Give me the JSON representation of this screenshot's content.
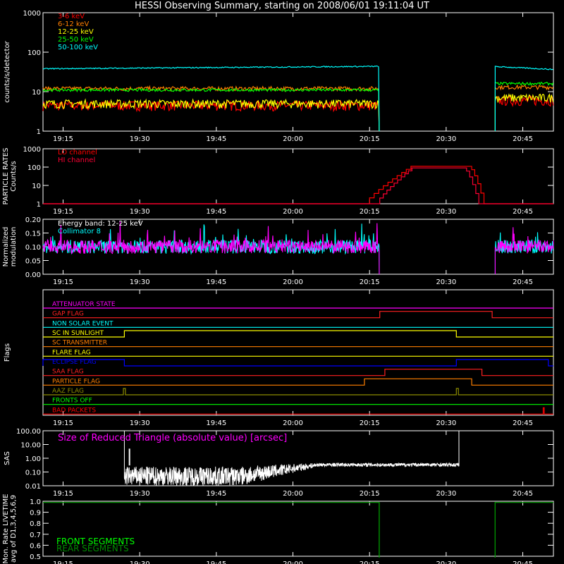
{
  "title": "HESSI Observing Summary, starting on 2008/06/01 19:11:04 UT",
  "time_ticks": [
    "19:15",
    "19:30",
    "19:45",
    "20:00",
    "20:15",
    "20:30",
    "20:45"
  ],
  "colors": {
    "background": "#000000",
    "frame": "#ffffff",
    "red": "#ff0000",
    "orange": "#ff7f00",
    "yellow": "#ffff00",
    "green": "#00ff00",
    "cyan": "#00ffff",
    "magenta": "#ff00ff",
    "blue": "#0000ff",
    "darkgreen": "#008c00",
    "olive": "#8c8c00"
  },
  "chart_data": [
    {
      "id": "countrates",
      "type": "line",
      "ylabel": "counts/s/detector",
      "yscale": "log",
      "ylim": [
        1,
        1000
      ],
      "yticks": [
        "1",
        "10",
        "100",
        "1000"
      ],
      "gap_minutes": [
        [
          20.28,
          20.66
        ]
      ],
      "series": [
        {
          "name": "3-6 keV",
          "color": "#ff0000",
          "level_before": 4.5,
          "level_after": 6
        },
        {
          "name": "6-12 keV",
          "color": "#ff7f00",
          "level_before": 12,
          "level_after": 13
        },
        {
          "name": "12-25 keV",
          "color": "#ffff00",
          "level_before": 5,
          "level_after": 7
        },
        {
          "name": "25-50 keV",
          "color": "#00ff00",
          "level_before": 11,
          "level_after": 16
        },
        {
          "name": "50-100 keV",
          "color": "#00ffff",
          "level_before": 38,
          "level_after": 43
        }
      ]
    },
    {
      "id": "particle",
      "type": "line",
      "ylabel_line1": "PARTICLE RATES",
      "ylabel_line2": "Counts/s",
      "yscale": "log",
      "ylim": [
        1,
        1000
      ],
      "yticks": [
        "1",
        "10",
        "100",
        "1000"
      ],
      "series": [
        {
          "name": "LO channel",
          "color": "#ff0000",
          "rise": [
            "20:15",
            "20:24"
          ],
          "plateau": 110,
          "fall": [
            "20:35",
            "20:38"
          ]
        },
        {
          "name": "HI channel",
          "color": "#ff0033",
          "rise": [
            "20:17",
            "20:24"
          ],
          "plateau": 90,
          "fall": [
            "20:34",
            "20:37"
          ]
        }
      ]
    },
    {
      "id": "modulation",
      "type": "line",
      "ylabel_line1": "Normalized",
      "ylabel_line2": "modulation",
      "ylim": [
        0.0,
        0.2
      ],
      "yticks": [
        "0.00",
        "0.05",
        "0.10",
        "0.15",
        "0.20"
      ],
      "series": [
        {
          "name": "Energy band: 12-25 keV",
          "color": "#ffffff"
        },
        {
          "name": "Collimator 8",
          "color": "#00ffff",
          "level": 0.1
        },
        {
          "name": "",
          "color": "#ff00ff",
          "level": 0.1
        }
      ]
    },
    {
      "id": "flags",
      "type": "line",
      "ylabel": "Flags",
      "flags": [
        {
          "name": "ATTENUATOR STATE",
          "color": "#ff00ff",
          "high": []
        },
        {
          "name": "GAP FLAG",
          "color": "#ff2020",
          "high": [
            [
              "20:17",
              "20:39"
            ]
          ]
        },
        {
          "name": "NON SOLAR EVENT",
          "color": "#00ffff",
          "high": []
        },
        {
          "name": "SC IN SUNLIGHT",
          "color": "#ffff00",
          "high": [
            [
              "19:27",
              "20:32"
            ]
          ]
        },
        {
          "name": "SC TRANSMITTER",
          "color": "#ff7f00",
          "high": []
        },
        {
          "name": "FLARE FLAG",
          "color": "#ffff00",
          "high": []
        },
        {
          "name": "ECLIPSE FLAG",
          "color": "#0000ff",
          "high": [
            [
              "19:11",
              "19:27"
            ],
            [
              "20:32",
              "20:50"
            ]
          ]
        },
        {
          "name": "SAA FLAG",
          "color": "#ff2020",
          "high": [
            [
              "20:18",
              "20:37"
            ]
          ]
        },
        {
          "name": "PARTICLE FLAG",
          "color": "#ff7f00",
          "high": [
            [
              "20:14",
              "20:35"
            ]
          ]
        },
        {
          "name": "AAZ FLAG",
          "color": "#8c8c00",
          "high": [
            [
              "19:26.8",
              "19:27.2"
            ],
            [
              "20:32",
              "20:32.4"
            ]
          ]
        },
        {
          "name": "FRONTS OFF",
          "color": "#00ff00",
          "high": []
        },
        {
          "name": "BAD PACKETS",
          "color": "#ff0000",
          "high": [
            [
              "20:49",
              "20:49.2"
            ]
          ]
        }
      ]
    },
    {
      "id": "sas",
      "type": "line",
      "ylabel": "SAS",
      "annotation": "Size of Reduced Triangle (absolute value) [arcsec]",
      "yscale": "log",
      "ylim": [
        0.01,
        100
      ],
      "yticks": [
        "0.01",
        "0.10",
        "1.00",
        "10.00",
        "100.00"
      ]
    },
    {
      "id": "livetime",
      "type": "line",
      "ylabel_line1": "Mon. Rate LIVETIME",
      "ylabel_line2": "avg of D1,3,4,5,6,9",
      "ylim": [
        0.5,
        1.0
      ],
      "yticks": [
        "0.5",
        "0.6",
        "0.7",
        "0.8",
        "0.9",
        "1.0"
      ],
      "series": [
        {
          "name": "FRONT SEGMENTS",
          "color": "#00ff00",
          "level": 0.99
        },
        {
          "name": "REAR SEGMENTS",
          "color": "#008c00",
          "level": 0.99
        }
      ]
    }
  ]
}
